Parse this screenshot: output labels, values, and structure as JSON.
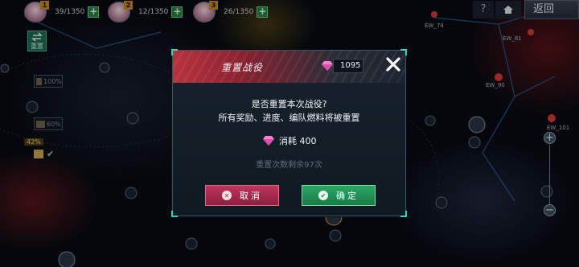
{
  "topbar": {
    "heroes": [
      {
        "level": "1",
        "fuel": "39/1350"
      },
      {
        "level": "2",
        "fuel": "12/1350"
      },
      {
        "level": "3",
        "fuel": "26/1350"
      }
    ],
    "help_icon": "?",
    "back_label": "返回"
  },
  "left": {
    "reset_label": "重置",
    "bonus_1": "100%",
    "bonus_2": "60%",
    "progress_badge": "42%"
  },
  "map": {
    "labels": [
      "EW_74",
      "EW_81",
      "EW_90",
      "EW_101"
    ]
  },
  "dialog": {
    "title": "重置战役",
    "gem_count": "1095",
    "question_line1": "是否重置本次战役?",
    "question_line2": "所有奖励、进度、编队燃料将被重置",
    "cost_label": "消耗 400",
    "remaining_label": "重置次数剩余97次",
    "cancel_label": "取消",
    "confirm_label": "确定"
  },
  "colors": {
    "accent_teal": "#3bd0b7",
    "cancel_pink": "#c0355d",
    "confirm_green": "#2aa864",
    "gem_pink": "#ff7fd0"
  }
}
